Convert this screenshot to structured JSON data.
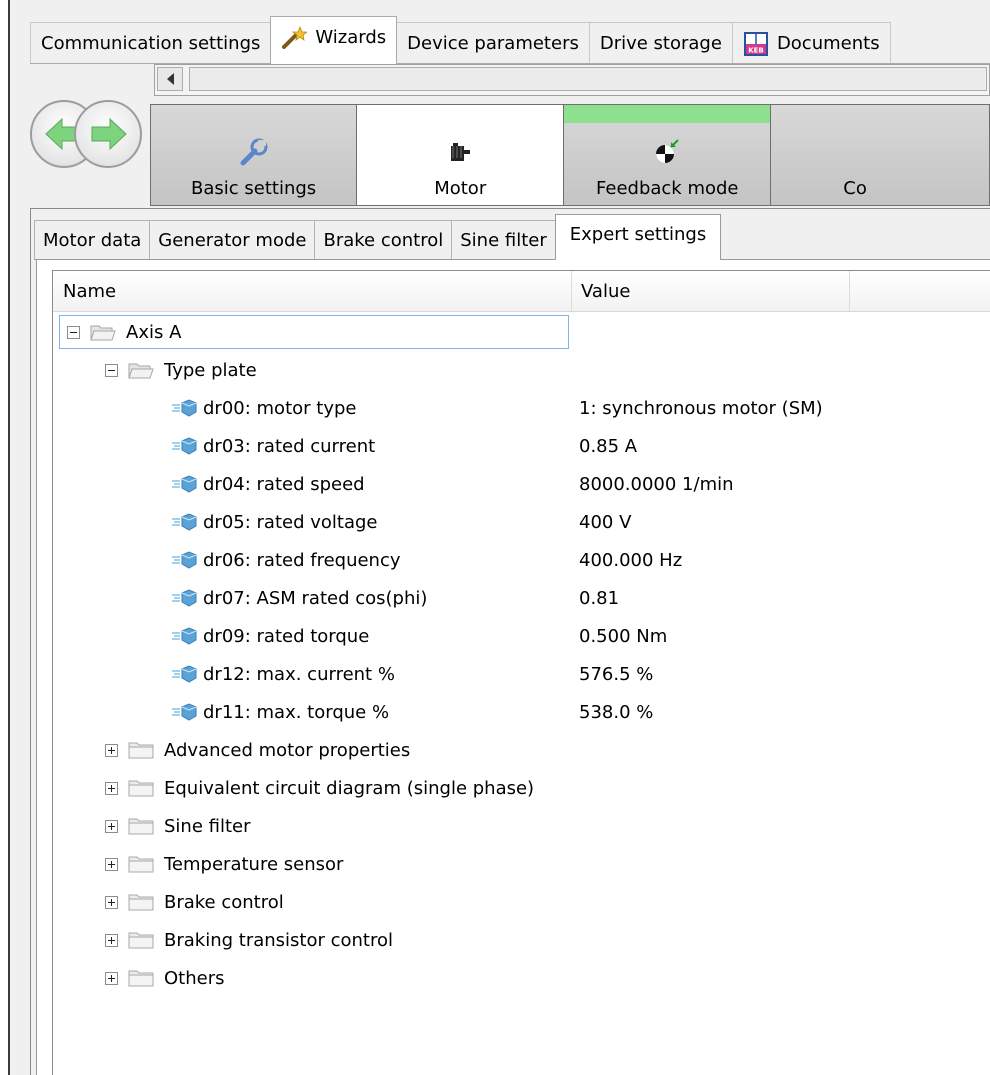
{
  "main_tabs": [
    {
      "label": "Communication settings",
      "icon": ""
    },
    {
      "label": "Wizards",
      "icon": "magic-wand-icon"
    },
    {
      "label": "Device parameters",
      "icon": ""
    },
    {
      "label": "Drive storage",
      "icon": ""
    },
    {
      "label": "Documents",
      "icon": "book-icon"
    }
  ],
  "active_main_tab": "Wizards",
  "documents_icon_text": "KEB",
  "wizard_steps": [
    {
      "label": "Basic settings",
      "icon": "wrench-icon",
      "state": "normal"
    },
    {
      "label": "Motor",
      "icon": "motor-icon",
      "state": "active"
    },
    {
      "label": "Feedback mode",
      "icon": "encoder-icon",
      "state": "completed"
    },
    {
      "label": "Co",
      "icon": "",
      "state": "normal"
    }
  ],
  "sub_tabs": [
    {
      "label": "Motor data"
    },
    {
      "label": "Generator mode"
    },
    {
      "label": "Brake control"
    },
    {
      "label": "Sine filter"
    },
    {
      "label": "Expert settings"
    }
  ],
  "active_sub_tab": "Expert settings",
  "columns": {
    "name": "Name",
    "value": "Value"
  },
  "tree": {
    "root": {
      "label": "Axis A",
      "expanded": true
    },
    "type_plate": {
      "label": "Type plate",
      "expanded": true
    },
    "parameters": [
      {
        "name": "dr00: motor type",
        "value": "1: synchronous motor (SM)"
      },
      {
        "name": "dr03: rated current",
        "value": "0.85 A"
      },
      {
        "name": "dr04: rated speed",
        "value": "8000.0000 1/min"
      },
      {
        "name": "dr05: rated voltage",
        "value": "400 V"
      },
      {
        "name": "dr06: rated frequency",
        "value": "400.000 Hz"
      },
      {
        "name": "dr07: ASM rated cos(phi)",
        "value": "0.81"
      },
      {
        "name": "dr09: rated torque",
        "value": "0.500 Nm"
      },
      {
        "name": "dr12: max. current %",
        "value": "576.5 %"
      },
      {
        "name": "dr11: max. torque %",
        "value": "538.0 %"
      }
    ],
    "collapsed_groups": [
      {
        "label": "Advanced motor properties"
      },
      {
        "label": "Equivalent circuit diagram (single phase)"
      },
      {
        "label": "Sine filter"
      },
      {
        "label": "Temperature sensor"
      },
      {
        "label": "Brake control"
      },
      {
        "label": "Braking transistor control"
      },
      {
        "label": "Others"
      }
    ]
  },
  "colors": {
    "completed_step": "#8ee08e",
    "selection_border": "#7eb4ea",
    "nav_arrow": "#7ed37e"
  }
}
